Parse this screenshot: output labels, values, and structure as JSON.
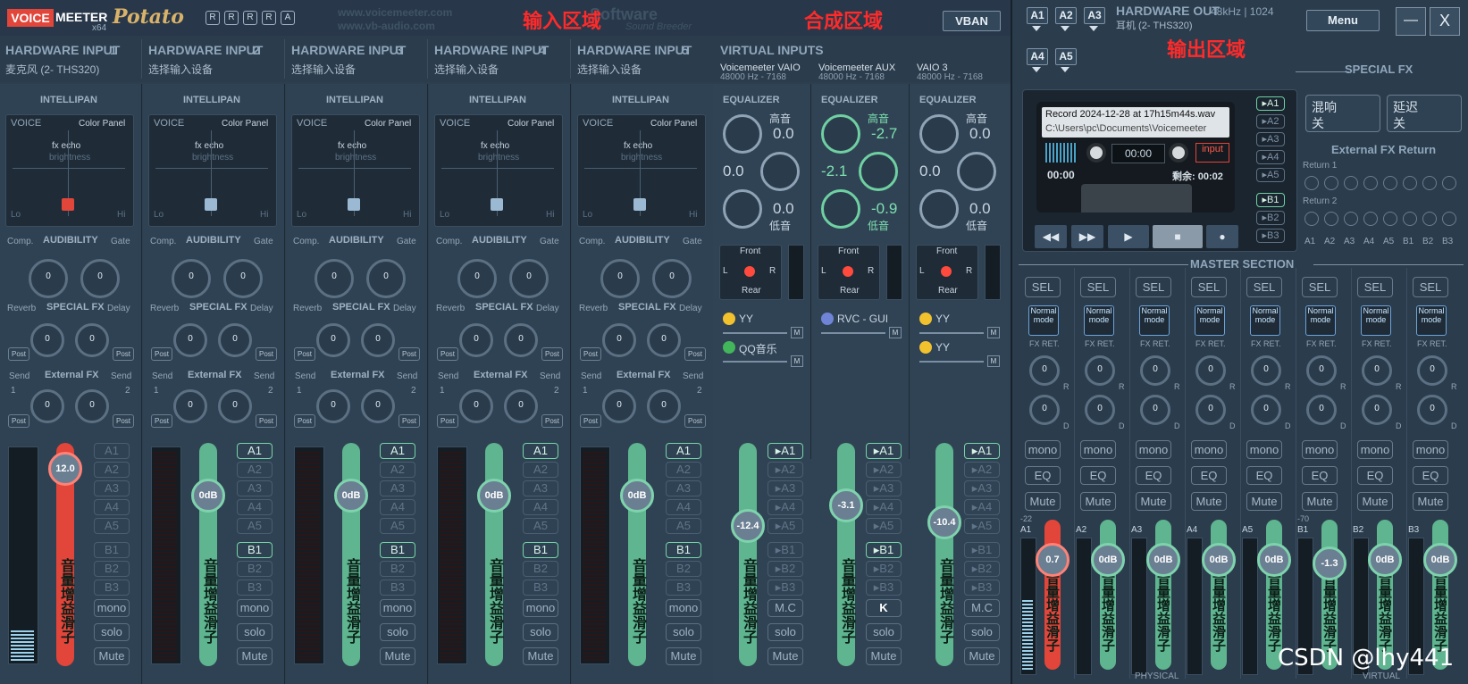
{
  "topbar": {
    "logo_voice": "VOICE",
    "logo_meter": "MEETER",
    "logo_x64": "x64",
    "logo_potato": "Potato",
    "r_buttons": [
      "R",
      "R",
      "R",
      "R",
      "A"
    ],
    "url1": "www.voicemeeter.com",
    "url2": "www.vb-audio.com",
    "vb_software": "Software",
    "vb_sub": "Sound Breeder",
    "vban": "VBAN",
    "menu": "Menu",
    "minimize": "—",
    "close": "X"
  },
  "annotations": {
    "input_area": "输入区域",
    "mix_area": "合成区域",
    "output_area": "输出区域"
  },
  "hardware_inputs": [
    {
      "title": "HARDWARE INPUT",
      "num": "1",
      "device": "麦克风 (2- THS320)",
      "gain": "12.0",
      "fader_color": "red"
    },
    {
      "title": "HARDWARE INPUT",
      "num": "2",
      "device": "选择输入设备",
      "gain": "0dB",
      "fader_color": "green"
    },
    {
      "title": "HARDWARE INPUT",
      "num": "3",
      "device": "选择输入设备",
      "gain": "0dB",
      "fader_color": "green"
    },
    {
      "title": "HARDWARE INPUT",
      "num": "4",
      "device": "选择输入设备",
      "gain": "0dB",
      "fader_color": "green"
    },
    {
      "title": "HARDWARE INPUT",
      "num": "5",
      "device": "选择输入设备",
      "gain": "0dB",
      "fader_color": "green"
    }
  ],
  "strip_labels": {
    "intellipan": "INTELLIPAN",
    "voice": "VOICE",
    "color_panel": "Color Panel",
    "fx_echo": "fx echo",
    "brightness": "brightness",
    "lo": "Lo",
    "hi": "Hi",
    "comp": "Comp.",
    "audibility": "AUDIBILITY",
    "gate": "Gate",
    "reverb": "Reverb",
    "special_fx": "SPECIAL FX",
    "delay": "Delay",
    "send": "Send",
    "external_fx": "External FX",
    "post": "Post",
    "knob_zero": "0",
    "one": "1",
    "two": "2",
    "fader_text": "音量增益滑子",
    "mono": "mono",
    "solo": "solo",
    "mute": "Mute",
    "mc": "M.C",
    "k": "K"
  },
  "bus_buttons": [
    "A1",
    "A2",
    "A3",
    "A4",
    "A5",
    "B1",
    "B2",
    "B3"
  ],
  "virtual_inputs": {
    "title": "VIRTUAL INPUTS",
    "strips": [
      {
        "device": "Voicemeeter VAIO",
        "freq": "48000 Hz - 7168",
        "eq_high": "0.0",
        "eq_mid": "0.0",
        "eq_low": "0.0",
        "gain": "-12.4",
        "app1": "YY",
        "app2": "QQ音乐",
        "extra_btn": "M.C"
      },
      {
        "device": "Voicemeeter AUX",
        "freq": "48000 Hz - 7168",
        "eq_high": "-2.7",
        "eq_mid": "-2.1",
        "eq_low": "-0.9",
        "gain": "-3.1",
        "app1": "RVC - GUI",
        "app2": "",
        "extra_btn": "K"
      },
      {
        "device": "VAIO 3",
        "freq": "48000 Hz - 7168",
        "eq_high": "0.0",
        "eq_mid": "0.0",
        "eq_low": "0.0",
        "gain": "-10.4",
        "app1": "YY",
        "app2": "YY",
        "extra_btn": "M.C"
      }
    ],
    "equalizer": "EQUALIZER",
    "high": "高音",
    "low": "低音",
    "front": "Front",
    "rear": "Rear",
    "l": "L",
    "r": "R",
    "m": "M"
  },
  "hardware_out": {
    "title": "HARDWARE OUT",
    "info": "48kHz | 1024",
    "device": "耳机 (2- THS320)",
    "a_buttons": [
      "A1",
      "A2",
      "A3",
      "A4",
      "A5"
    ]
  },
  "special_fx_right": {
    "title": "SPECIAL FX",
    "reverb": "混响",
    "reverb_state": "关",
    "delay": "延迟",
    "delay_state": "关",
    "ext_return": "External FX Return",
    "return1": "Return 1",
    "return2": "Return 2",
    "bus_labels": [
      "A1",
      "A2",
      "A3",
      "A4",
      "A5",
      "B1",
      "B2",
      "B3"
    ]
  },
  "recorder": {
    "filename": "Record 2024-12-28 at 17h15m44s.wav",
    "path": "C:\\Users\\pc\\Documents\\Voicemeeter",
    "time": "00:00",
    "input_label": "input",
    "elapsed": "00:00",
    "remaining": "剩余: 00:02",
    "buses": [
      "A1",
      "A2",
      "A3",
      "A4",
      "A5",
      "B1",
      "B2",
      "B3"
    ]
  },
  "master": {
    "title": "MASTER SECTION",
    "sel": "SEL",
    "normal_mode": "Normal mode",
    "fx_ret": "FX RET.",
    "r": "R",
    "d": "D",
    "mono": "mono",
    "eq": "EQ",
    "mute": "Mute",
    "physical": "PHYSICAL",
    "virtual": "VIRTUAL",
    "strips": [
      {
        "name": "A1",
        "gain": "0.7",
        "level": "-22",
        "color": "red"
      },
      {
        "name": "A2",
        "gain": "0dB",
        "level": "",
        "color": "green"
      },
      {
        "name": "A3",
        "gain": "0dB",
        "level": "",
        "color": "green"
      },
      {
        "name": "A4",
        "gain": "0dB",
        "level": "",
        "color": "green"
      },
      {
        "name": "A5",
        "gain": "0dB",
        "level": "",
        "color": "green"
      },
      {
        "name": "B1",
        "gain": "-1.3",
        "level": "-70",
        "color": "green"
      },
      {
        "name": "B2",
        "gain": "0dB",
        "level": "",
        "color": "green"
      },
      {
        "name": "B3",
        "gain": "0dB",
        "level": "",
        "color": "green"
      }
    ]
  },
  "watermark": "CSDN @lhy441"
}
